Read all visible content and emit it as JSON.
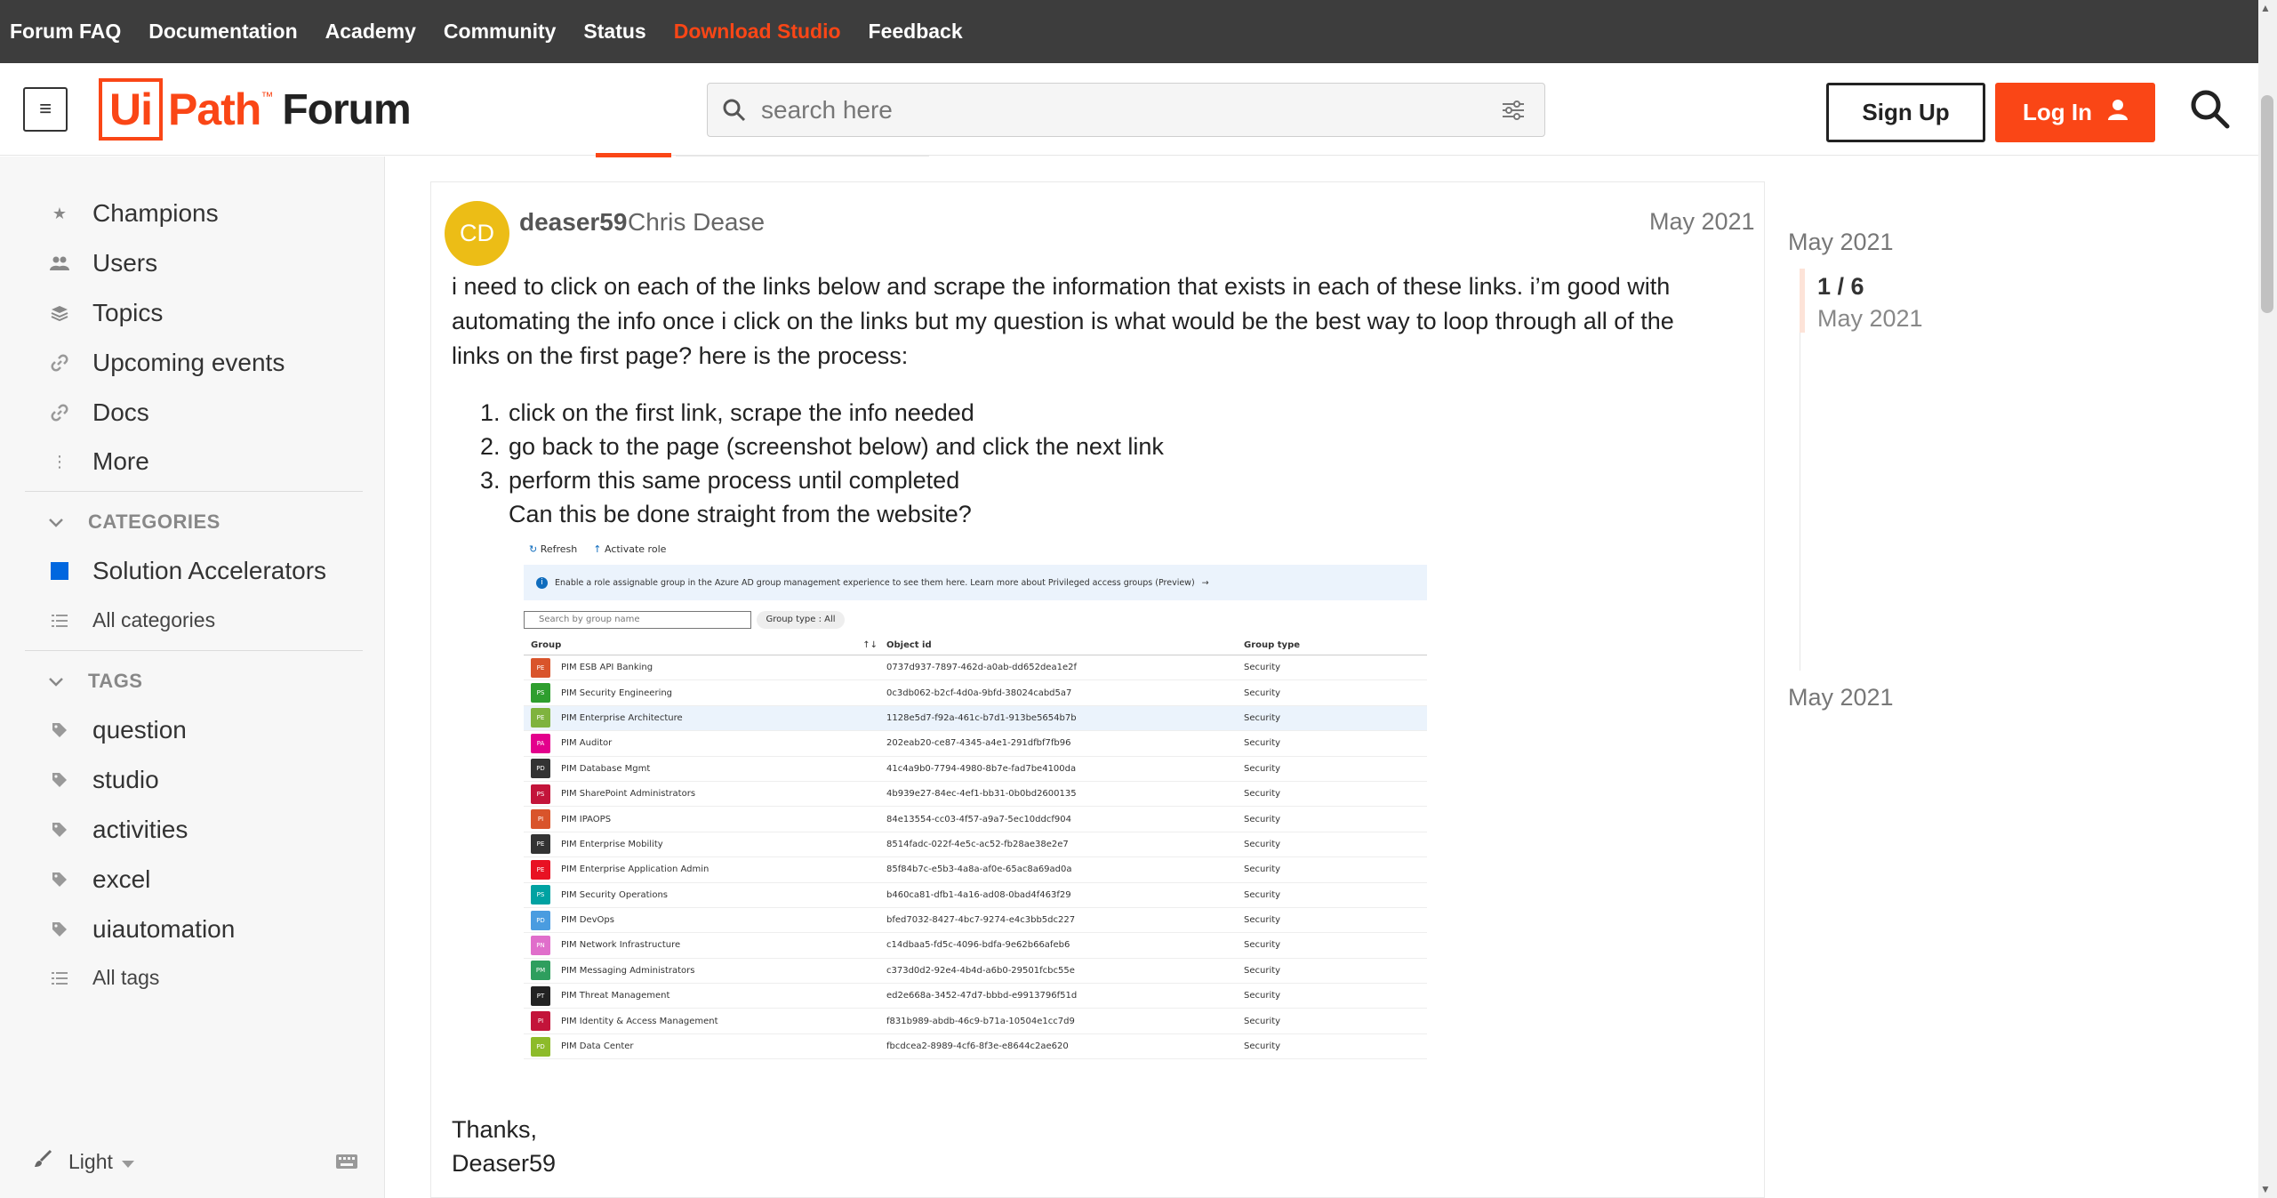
{
  "topnav": {
    "items": [
      "Forum FAQ",
      "Documentation",
      "Academy",
      "Community",
      "Status",
      "Download Studio",
      "Feedback"
    ]
  },
  "header": {
    "logo_ui": "Ui",
    "logo_path": "Path",
    "logo_tm": "™",
    "logo_forum": "Forum",
    "search_placeholder": "search here",
    "signup_label": "Sign Up",
    "login_label": "Log In"
  },
  "sidebar": {
    "items": [
      {
        "label": "Champions",
        "icon": "star-icon"
      },
      {
        "label": "Users",
        "icon": "users-icon"
      },
      {
        "label": "Topics",
        "icon": "layers-icon"
      },
      {
        "label": "Upcoming events",
        "icon": "link-icon"
      },
      {
        "label": "Docs",
        "icon": "link-icon"
      },
      {
        "label": "More",
        "icon": "more-vertical-icon"
      }
    ],
    "categories_heading": "CATEGORIES",
    "categories": [
      {
        "label": "Solution Accelerators",
        "color": "#0067df"
      }
    ],
    "all_categories": "All categories",
    "tags_heading": "TAGS",
    "tags": [
      "question",
      "studio",
      "activities",
      "excel",
      "uiautomation"
    ],
    "all_tags": "All tags",
    "theme_label": "Light"
  },
  "post": {
    "avatar_initials": "CD",
    "avatar_color": "#ecbd16",
    "username": "deaser59",
    "fullname": "Chris Dease",
    "date": "May 2021",
    "body_line1": "i need to click on each of the links below and scrape the information that exists in each of these links. i’m good with",
    "body_line2": "automating the info once i click on the links but my question is what would be the best way to loop through all of the",
    "body_line3": "links on the first page? here is the process:",
    "steps": [
      "click on the first link, scrape the info needed",
      "go back to the page (screenshot below) and click the next link",
      "perform this same process until completed"
    ],
    "step_followup": "Can this be done straight from the website?",
    "signoff1": "Thanks,",
    "signoff2": "Deaser59"
  },
  "screenshot": {
    "refresh_label": "Refresh",
    "activate_label": "Activate role",
    "banner_text": "Enable a role assignable group in the Azure AD group management experience to see them here. Learn more about Privileged access groups (Preview)",
    "search_placeholder": "Search by group name",
    "filter_label": "Group type : All",
    "columns": [
      "Group",
      "Object id",
      "Group type"
    ],
    "rows": [
      {
        "badge": "PE",
        "color": "#d9542b",
        "group": "PIM ESB API Banking",
        "object_id": "0737d937-7897-462d-a0ab-dd652dea1e2f",
        "type": "Security"
      },
      {
        "badge": "PS",
        "color": "#2e9e2e",
        "group": "PIM Security Engineering",
        "object_id": "0c3db062-b2cf-4d0a-9bfd-38024cabd5a7",
        "type": "Security"
      },
      {
        "badge": "PE",
        "color": "#7fb33e",
        "group": "PIM Enterprise Architecture",
        "object_id": "1128e5d7-f92a-461c-b7d1-913be5654b7b",
        "type": "Security",
        "selected": true
      },
      {
        "badge": "PA",
        "color": "#e3008c",
        "group": "PIM Auditor",
        "object_id": "202eab20-ce87-4345-a4e1-291dfbf7fb96",
        "type": "Security"
      },
      {
        "badge": "PD",
        "color": "#333333",
        "group": "PIM Database Mgmt",
        "object_id": "41c4a9b0-7794-4980-8b7e-fad7be4100da",
        "type": "Security"
      },
      {
        "badge": "PS",
        "color": "#c3143a",
        "group": "PIM SharePoint Administrators",
        "object_id": "4b939e27-84ec-4ef1-bb31-0b0bd2600135",
        "type": "Security"
      },
      {
        "badge": "PI",
        "color": "#d9542b",
        "group": "PIM IPAOPS",
        "object_id": "84e13554-cc03-4f57-a9a7-5ec10ddcf904",
        "type": "Security"
      },
      {
        "badge": "PE",
        "color": "#333333",
        "group": "PIM Enterprise Mobility",
        "object_id": "8514fadc-022f-4e5c-ac52-fb28ae38e2e7",
        "type": "Security"
      },
      {
        "badge": "PE",
        "color": "#e81123",
        "group": "PIM Enterprise Application Admin",
        "object_id": "85f84b7c-e5b3-4a8a-af0e-65ac8a69ad0a",
        "type": "Security"
      },
      {
        "badge": "PS",
        "color": "#00a2a2",
        "group": "PIM Security Operations",
        "object_id": "b460ca81-dfb1-4a16-ad08-0bad4f463f29",
        "type": "Security"
      },
      {
        "badge": "PD",
        "color": "#4a9ce0",
        "group": "PIM DevOps",
        "object_id": "bfed7032-8427-4bc7-9274-e4c3bb5dc227",
        "type": "Security"
      },
      {
        "badge": "PN",
        "color": "#e06ecb",
        "group": "PIM Network Infrastructure",
        "object_id": "c14dbaa5-fd5c-4096-bdfa-9e62b66afeb6",
        "type": "Security"
      },
      {
        "badge": "PM",
        "color": "#2e9e5e",
        "group": "PIM Messaging Administrators",
        "object_id": "c373d0d2-92e4-4b4d-a6b0-29501fcbc55e",
        "type": "Security"
      },
      {
        "badge": "PT",
        "color": "#222222",
        "group": "PIM Threat Management",
        "object_id": "ed2e668a-3452-47d7-bbbd-e9913796f51d",
        "type": "Security"
      },
      {
        "badge": "PI",
        "color": "#c3143a",
        "group": "PIM Identity & Access Management",
        "object_id": "f831b989-abdb-46c9-b71a-10504e1cc7d9",
        "type": "Security"
      },
      {
        "badge": "PD",
        "color": "#8dbb2a",
        "group": "PIM Data Center",
        "object_id": "fbcdcea2-8989-4cf6-8f3e-e8644c2ae620",
        "type": "Security"
      }
    ]
  },
  "timeline": {
    "start_date": "May 2021",
    "count": "1 / 6",
    "current_date": "May 2021",
    "end_date": "May 2021"
  },
  "colors": {
    "accent": "#fa4616",
    "topbar": "#3d3d3d"
  }
}
